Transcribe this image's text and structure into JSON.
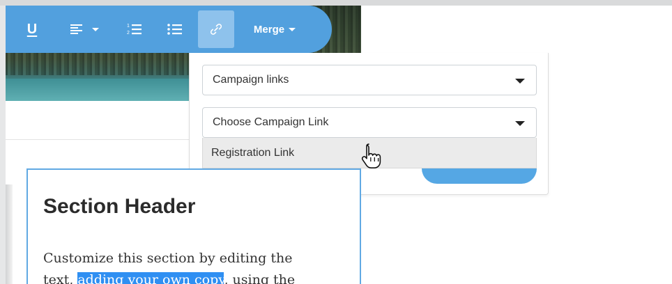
{
  "toolbar": {
    "underline_label": "U",
    "merge_label": "Merge"
  },
  "link_popover": {
    "link_type_select": "Campaign links",
    "campaign_link_select": "Choose Campaign Link",
    "dropdown_option": "Registration Link"
  },
  "content": {
    "section_header": "Section Header",
    "body_line1": "Customize this section by editing the",
    "body_line2_start": "text, ",
    "body_highlight": "adding your own copy",
    "body_line2_end": ", using the"
  },
  "colors": {
    "toolbar": "#52a0de",
    "toolbar_active": "#8ec2ec",
    "selection_highlight": "#2f8ff2",
    "section_border": "#61a9e3"
  },
  "icons": [
    "underline-icon",
    "align-left-icon",
    "numbered-list-icon",
    "bullet-list-icon",
    "link-icon",
    "caret-down-icon",
    "hand-cursor-icon"
  ]
}
